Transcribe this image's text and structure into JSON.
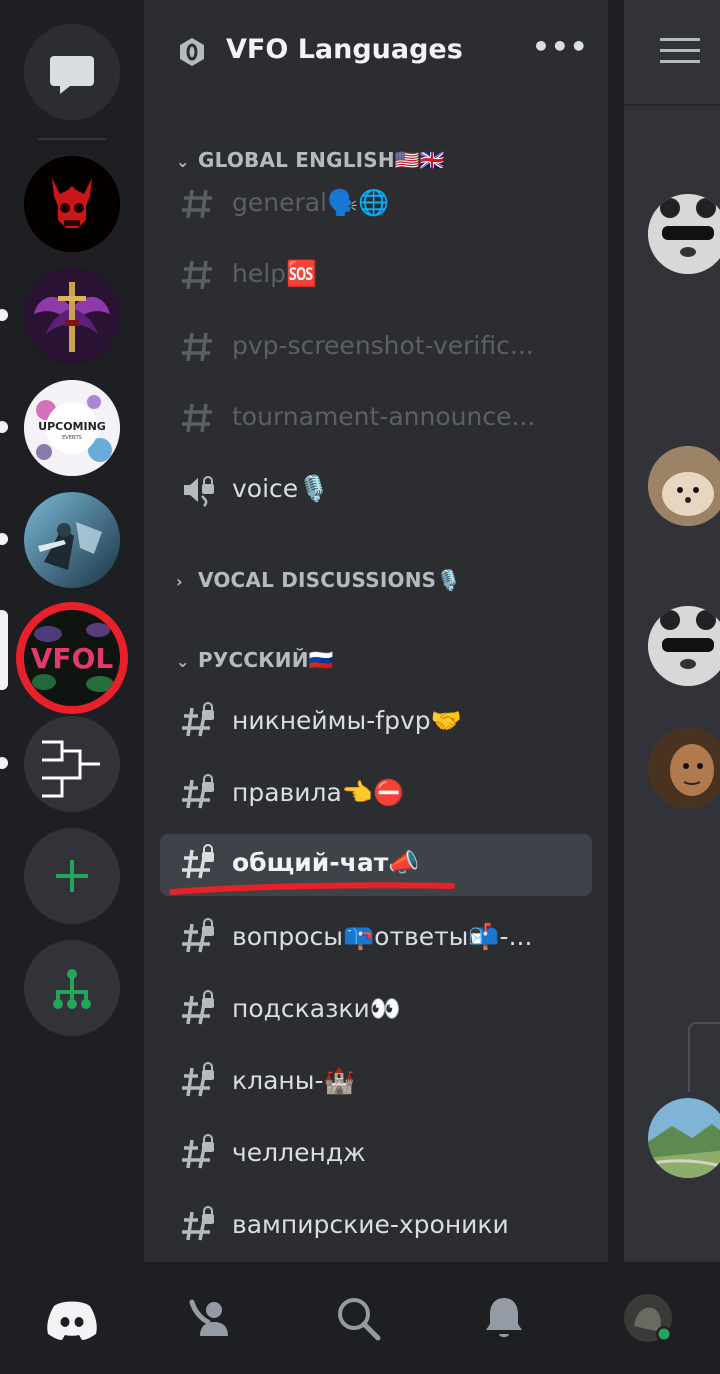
{
  "server": {
    "name": "VFO Languages",
    "more_label": "•••"
  },
  "categories": [
    {
      "label": "GLOBAL ENGLISH🇺🇸🇬🇧",
      "expanded": true,
      "channels": [
        {
          "name": "general🗣️🌐",
          "type": "text",
          "state": "muted"
        },
        {
          "name": "help🆘",
          "type": "text",
          "state": "muted"
        },
        {
          "name": "pvp-screenshot-verific...",
          "type": "text",
          "state": "muted"
        },
        {
          "name": "tournament-announce...",
          "type": "text",
          "state": "muted"
        },
        {
          "name": "voice🎙️",
          "type": "voice",
          "state": "unread"
        }
      ]
    },
    {
      "label": "VOCAL DISCUSSIONS🎙️",
      "expanded": false,
      "channels": []
    },
    {
      "label": "РУССКИЙ🇷🇺",
      "expanded": true,
      "channels": [
        {
          "name": "никнеймы-fpvp🤝",
          "type": "locked",
          "state": "normal"
        },
        {
          "name": "правила👈⛔",
          "type": "locked",
          "state": "normal"
        },
        {
          "name": "общий-чат📣",
          "type": "locked",
          "state": "active"
        },
        {
          "name": "вопросы📪ответы📬-...",
          "type": "locked",
          "state": "normal"
        },
        {
          "name": "подсказки👀",
          "type": "locked",
          "state": "normal"
        },
        {
          "name": "кланы-🏰",
          "type": "locked",
          "state": "normal"
        },
        {
          "name": "челлендж",
          "type": "locked",
          "state": "normal"
        },
        {
          "name": "вампирские-хроники",
          "type": "locked",
          "state": "normal"
        }
      ]
    }
  ],
  "servers": [
    {
      "icon": "messages-icon"
    },
    {
      "icon": "red-devil-skull-server"
    },
    {
      "icon": "winged-sword-server",
      "unread": true
    },
    {
      "icon": "upcoming-events-server",
      "unread": true,
      "text": "UPCOMING"
    },
    {
      "icon": "warrior-art-server",
      "unread": true
    },
    {
      "icon": "vfol-server",
      "selected": true,
      "highlighted": true,
      "text": "VFOL"
    },
    {
      "icon": "bracket-server",
      "unread": true
    },
    {
      "icon": "add-server-icon"
    },
    {
      "icon": "discover-hubs-icon"
    }
  ],
  "bottom_nav": [
    "discord-home-icon",
    "friends-icon",
    "search-icon",
    "notifications-icon",
    "profile-avatar"
  ],
  "colors": {
    "background": "#1e1f22",
    "panel": "#2b2d31",
    "active": "#404249",
    "accent_green": "#23a55a",
    "annotation_red": "#e8202a"
  }
}
